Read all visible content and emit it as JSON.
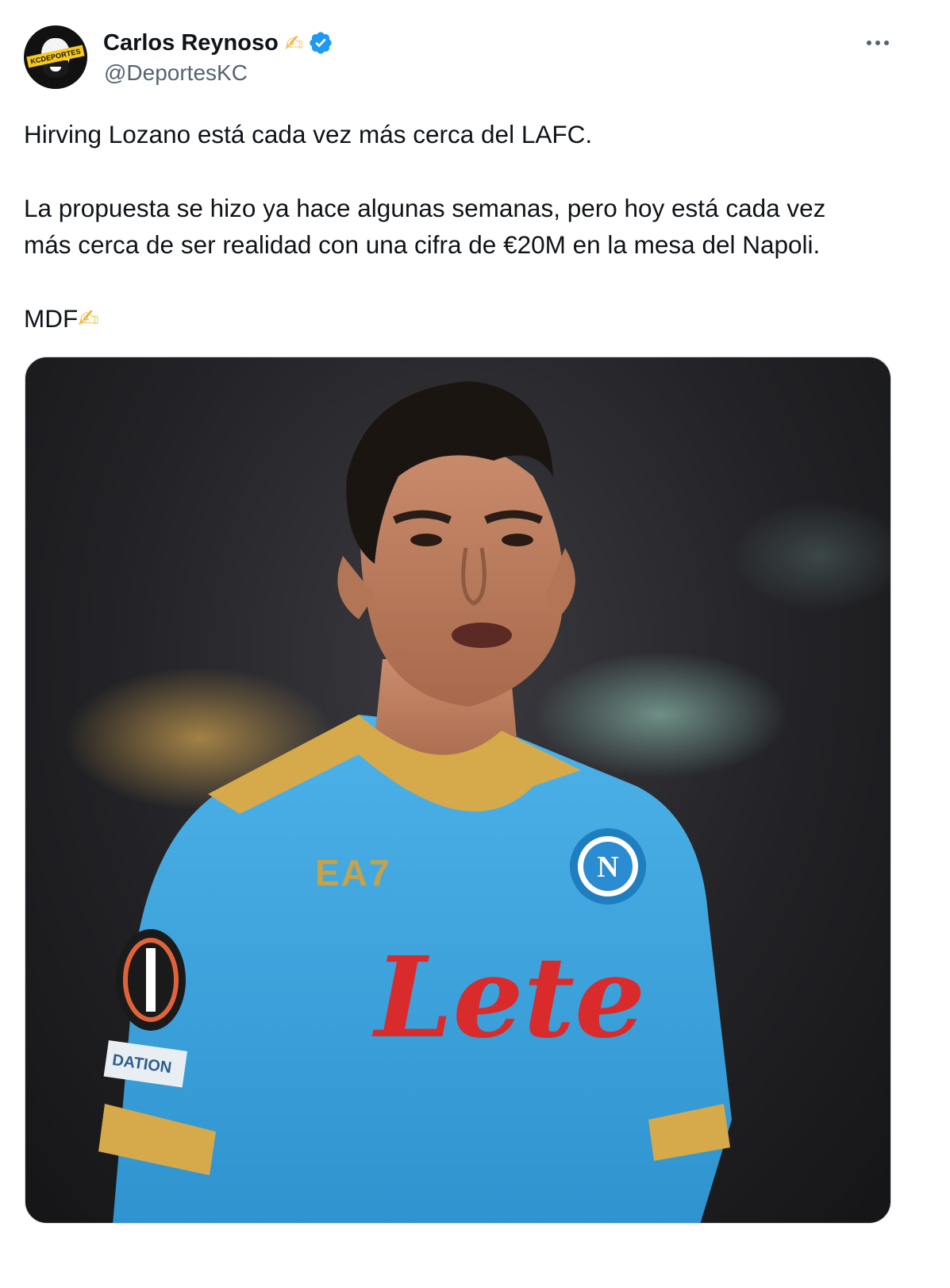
{
  "tweet": {
    "author": {
      "display_name": "Carlos Reynoso",
      "name_emoji": "✍",
      "handle": "@DeportesKC",
      "avatar_badge_text": "KCDEPORTES",
      "verified_icon": "verified-badge-icon"
    },
    "text": {
      "line1": "Hirving Lozano está cada vez más cerca del LAFC.",
      "line2": "La propuesta se hizo ya hace algunas semanas, pero hoy está cada vez",
      "line3": "más cerca de ser realidad con una cifra de €20M en la mesa del Napoli.",
      "signature": "MDF",
      "signature_emoji": "✍"
    },
    "media": {
      "jersey_brand": "EA7",
      "sponsor": "Lete",
      "crest_letter": "N",
      "sleeve_patch_text": "DATION"
    },
    "colors": {
      "text_primary": "#0f1419",
      "text_secondary": "#536471",
      "verified_blue": "#1d9bf0",
      "jersey_blue": "#3fa7e0",
      "jersey_gold": "#d6a94a",
      "sponsor_red": "#d92b2b"
    }
  }
}
